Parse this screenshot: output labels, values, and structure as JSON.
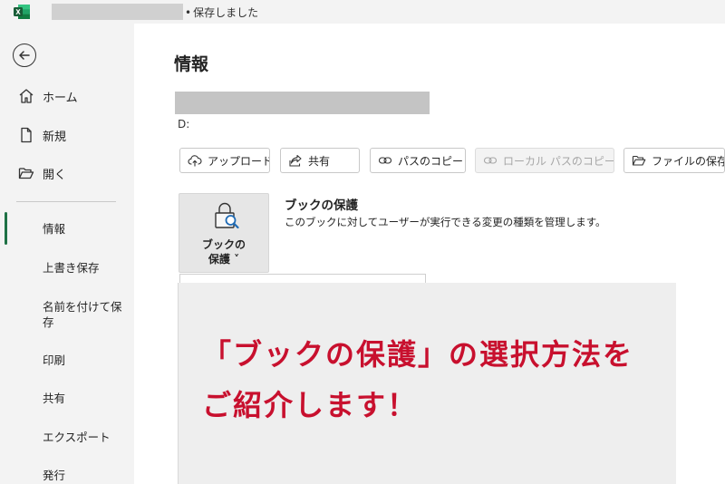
{
  "titlebar": {
    "status": "保存しました"
  },
  "nav": {
    "items": [
      {
        "label": "ホーム"
      },
      {
        "label": "新規"
      },
      {
        "label": "開く"
      }
    ],
    "sections": [
      {
        "label": "情報"
      },
      {
        "label": "上書き保存"
      },
      {
        "label": "名前を付けて保存"
      },
      {
        "label": "印刷"
      },
      {
        "label": "共有"
      },
      {
        "label": "エクスポート"
      },
      {
        "label": "発行"
      }
    ]
  },
  "main": {
    "title": "情報",
    "path_drive": "D:",
    "actions": [
      {
        "label": "アップロード"
      },
      {
        "label": "共有"
      },
      {
        "label": "パスのコピー"
      },
      {
        "label": "ローカル パスのコピー"
      },
      {
        "label": "ファイルの保存"
      }
    ],
    "protect": {
      "button_line1": "ブックの",
      "button_line2": "保護 ˅",
      "title": "ブックの保護",
      "description": "このブックに対してユーザーが実行できる変更の種類を管理します。"
    }
  },
  "overlay": {
    "line1": "「ブックの保護」の選択方法を",
    "line2": "ご紹介します！"
  },
  "colors": {
    "accent_green": "#1e7145",
    "caption_red": "#c8102e"
  }
}
